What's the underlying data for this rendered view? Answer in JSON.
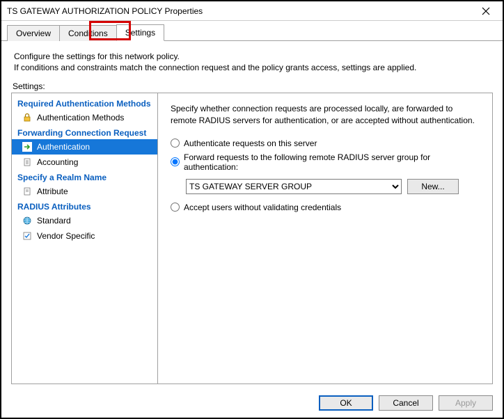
{
  "window": {
    "title": "TS GATEWAY AUTHORIZATION POLICY Properties"
  },
  "tabs": {
    "overview": "Overview",
    "conditions": "Conditions",
    "settings": "Settings"
  },
  "intro": {
    "line1": "Configure the settings for this network policy.",
    "line2": "If conditions and constraints match the connection request and the policy grants access, settings are applied."
  },
  "settings_label": "Settings:",
  "sidebar": {
    "group_auth": "Required Authentication Methods",
    "item_auth_methods": "Authentication Methods",
    "group_forward": "Forwarding Connection Request",
    "item_authentication": "Authentication",
    "item_accounting": "Accounting",
    "group_realm": "Specify a Realm Name",
    "item_attribute": "Attribute",
    "group_radius": "RADIUS Attributes",
    "item_standard": "Standard",
    "item_vendor": "Vendor Specific"
  },
  "content": {
    "intro": "Specify whether connection requests are processed locally, are forwarded to remote RADIUS servers for authentication, or are accepted without authentication.",
    "radio_local": "Authenticate requests on this server",
    "radio_forward": "Forward requests to the following remote RADIUS server group for authentication:",
    "radio_accept": "Accept users without validating credentials",
    "server_group": "TS GATEWAY SERVER GROUP",
    "new_button": "New..."
  },
  "footer": {
    "ok": "OK",
    "cancel": "Cancel",
    "apply": "Apply"
  }
}
